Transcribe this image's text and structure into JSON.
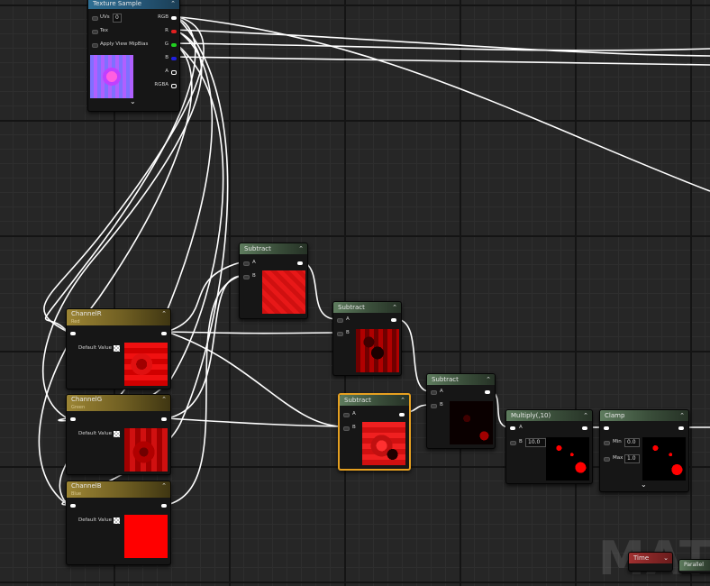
{
  "canvas": {
    "watermark": "MATE"
  },
  "texture_sample": {
    "title": "Texture Sample",
    "inputs": [
      "UVs",
      "Tex",
      "Apply View MipBias"
    ],
    "uvs_value": "0",
    "outputs": [
      "RGB",
      "R",
      "G",
      "B",
      "A",
      "RGBA"
    ]
  },
  "channel_r": {
    "title": "ChannelR",
    "subtitle": "Red",
    "default_label": "Default Value"
  },
  "channel_g": {
    "title": "ChannelG",
    "subtitle": "Green",
    "default_label": "Default Value"
  },
  "channel_b": {
    "title": "ChannelB",
    "subtitle": "Blue",
    "default_label": "Default Value"
  },
  "subtract_1": {
    "title": "Subtract",
    "pin_a": "A",
    "pin_b": "B"
  },
  "subtract_2": {
    "title": "Subtract",
    "pin_a": "A",
    "pin_b": "B"
  },
  "subtract_3": {
    "title": "Subtract",
    "pin_a": "A",
    "pin_b": "B"
  },
  "subtract_4": {
    "title": "Subtract",
    "pin_a": "A",
    "pin_b": "B"
  },
  "multiply": {
    "title": "Multiply(,10)",
    "pin_a": "A",
    "pin_b": "B",
    "b_value": "10.0"
  },
  "clamp": {
    "title": "Clamp",
    "min_label": "Min",
    "min_value": "0.0",
    "max_label": "Max",
    "max_value": "1.0"
  },
  "time_node": {
    "title": "Time"
  },
  "partial_node": {
    "title": "Parallel"
  },
  "colors": {
    "wire": "#ffffff",
    "selection": "#e6a020",
    "pin_r": "#e02020",
    "pin_g": "#20d020",
    "pin_b": "#2020e0"
  }
}
